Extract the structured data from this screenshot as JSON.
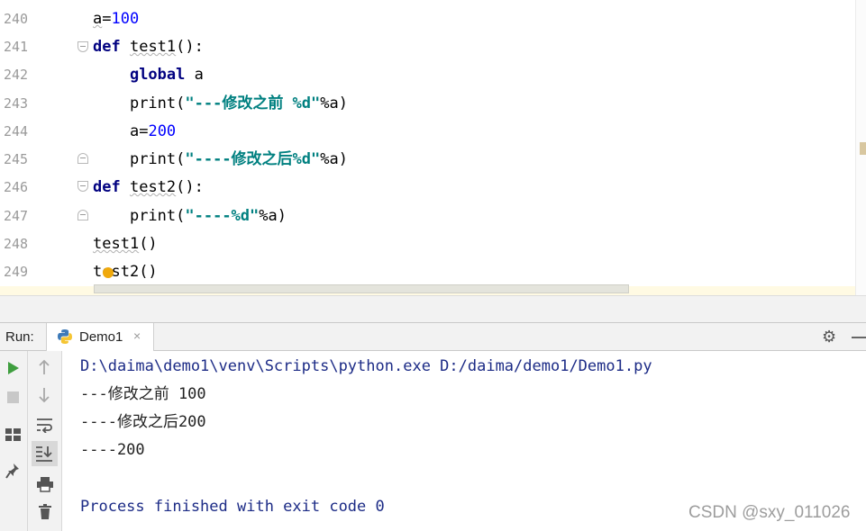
{
  "editor": {
    "line_numbers": [
      "240",
      "241",
      "242",
      "243",
      "244",
      "245",
      "246",
      "247",
      "248",
      "249"
    ],
    "lines": [
      {
        "indent": "",
        "tokens": [
          {
            "t": "a",
            "c": "plain",
            "sq": true
          },
          {
            "t": "=",
            "c": "plain"
          },
          {
            "t": "100",
            "c": "num"
          }
        ]
      },
      {
        "indent": "",
        "tokens": [
          {
            "t": "def",
            "c": "kw"
          },
          {
            "t": " ",
            "c": "plain"
          },
          {
            "t": "test1",
            "c": "plain",
            "sq": true
          },
          {
            "t": "():",
            "c": "plain"
          }
        ]
      },
      {
        "indent": "    ",
        "tokens": [
          {
            "t": "global",
            "c": "kw"
          },
          {
            "t": " a",
            "c": "plain"
          }
        ]
      },
      {
        "indent": "    ",
        "tokens": [
          {
            "t": "print(",
            "c": "plain"
          },
          {
            "t": "\"---修改之前 %d\"",
            "c": "str"
          },
          {
            "t": "%a)",
            "c": "plain"
          }
        ]
      },
      {
        "indent": "    ",
        "tokens": [
          {
            "t": "a",
            "c": "plain"
          },
          {
            "t": "=",
            "c": "plain"
          },
          {
            "t": "200",
            "c": "num"
          }
        ]
      },
      {
        "indent": "    ",
        "tokens": [
          {
            "t": "print(",
            "c": "plain"
          },
          {
            "t": "\"----修改之后%d\"",
            "c": "str"
          },
          {
            "t": "%a)",
            "c": "plain"
          }
        ]
      },
      {
        "indent": "",
        "tokens": [
          {
            "t": "def",
            "c": "kw"
          },
          {
            "t": " ",
            "c": "plain"
          },
          {
            "t": "test2",
            "c": "plain",
            "sq": true
          },
          {
            "t": "():",
            "c": "plain"
          }
        ]
      },
      {
        "indent": "    ",
        "tokens": [
          {
            "t": "print(",
            "c": "plain"
          },
          {
            "t": "\"----%d\"",
            "c": "str"
          },
          {
            "t": "%a)",
            "c": "plain"
          }
        ]
      },
      {
        "indent": "",
        "tokens": [
          {
            "t": "test1",
            "c": "plain",
            "sq": true
          },
          {
            "t": "()",
            "c": "plain"
          }
        ]
      },
      {
        "indent": "",
        "tokens": [
          {
            "t": "test2",
            "c": "plain"
          },
          {
            "t": "()",
            "c": "plain"
          }
        ]
      }
    ]
  },
  "run": {
    "label": "Run:",
    "tab_label": "Demo1",
    "tab_close": "×",
    "icons": {
      "gear": "gear-icon",
      "python": "python-icon",
      "minimize": "minimize-icon"
    },
    "toolbar_left": [
      "run-icon",
      "stop-icon",
      "layout-icon",
      "pin-icon"
    ],
    "toolbar_right": [
      "arrow-up-icon",
      "arrow-down-icon",
      "soft-wrap-icon",
      "scroll-to-end-icon",
      "print-icon",
      "trash-icon"
    ]
  },
  "console": {
    "command": "D:\\daima\\demo1\\venv\\Scripts\\python.exe D:/daima/demo1/Demo1.py",
    "out1": "---修改之前 100",
    "out2": "----修改之后200",
    "out3": "----200",
    "finished": "Process finished with exit code 0"
  },
  "watermark": "CSDN @sxy_011026",
  "colors": {
    "keyword": "#000080",
    "number": "#0000ff",
    "string": "#008080",
    "console_cmd": "#1c2b86",
    "run_green": "#3f9e3f"
  }
}
